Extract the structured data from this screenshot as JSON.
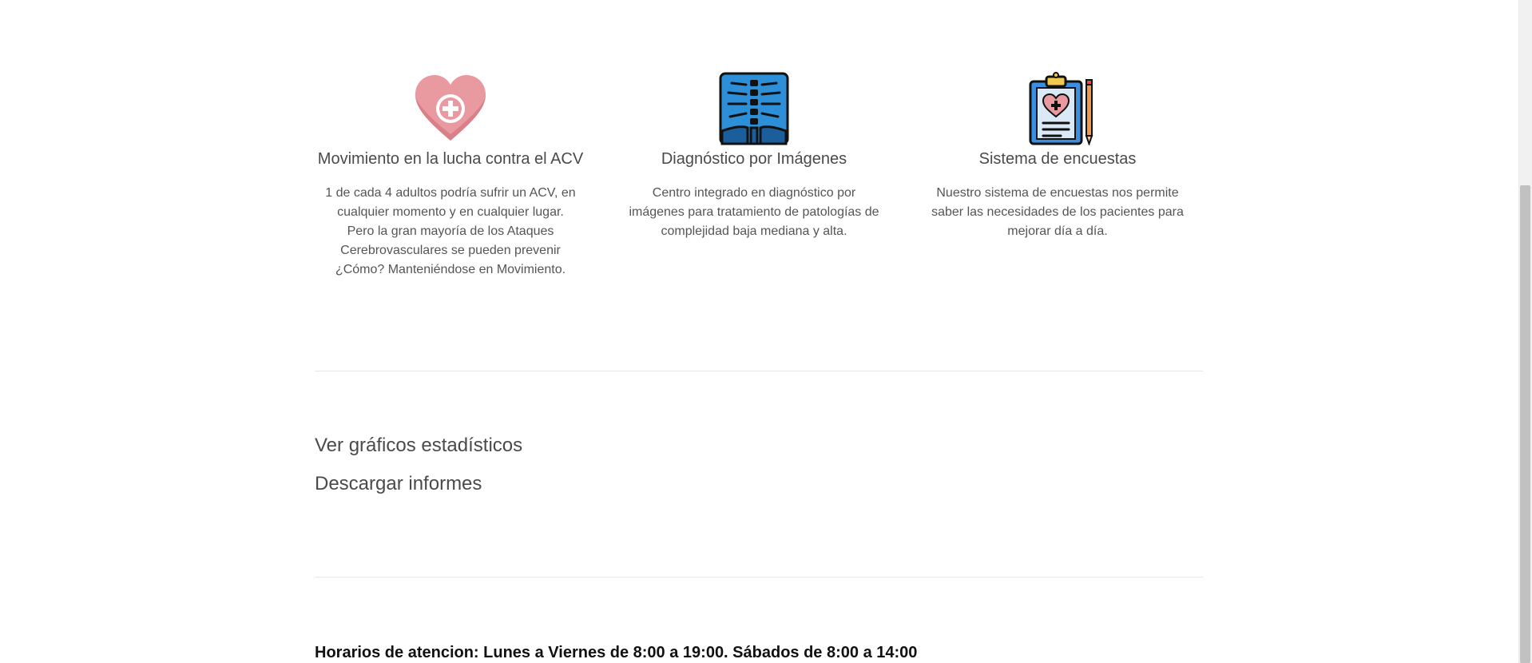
{
  "features": [
    {
      "icon": "heart-plus-icon",
      "title": "Movimiento en la lucha contra el ACV",
      "description": "1 de cada 4 adultos podría sufrir un ACV, en cualquier momento y en cualquier lugar. Pero la gran mayoría de los Ataques Cerebrovasculares se pueden prevenir ¿Cómo? Manteniéndose en Movimiento."
    },
    {
      "icon": "xray-icon",
      "title": "Diagnóstico por Imágenes",
      "description": "Centro integrado en diagnóstico por imágenes para tratamiento de patologías de complejidad baja mediana y alta."
    },
    {
      "icon": "clipboard-survey-icon",
      "title": "Sistema de encuestas",
      "description": "Nuestro sistema de encuestas nos permite saber las necesidades de los pacientes para mejorar día a día."
    }
  ],
  "links": {
    "stats": "Ver gráficos estadísticos",
    "reports": "Descargar informes"
  },
  "footer": {
    "hours": "Horarios de atencion: Lunes a Viernes de 8:00 a 19:00. Sábados de 8:00 a 14:00"
  },
  "colors": {
    "heart": "#e89aa0",
    "xray_bg": "#2d8fd8",
    "clipboard": "#3b8fe0",
    "text": "#4a4a4a"
  }
}
